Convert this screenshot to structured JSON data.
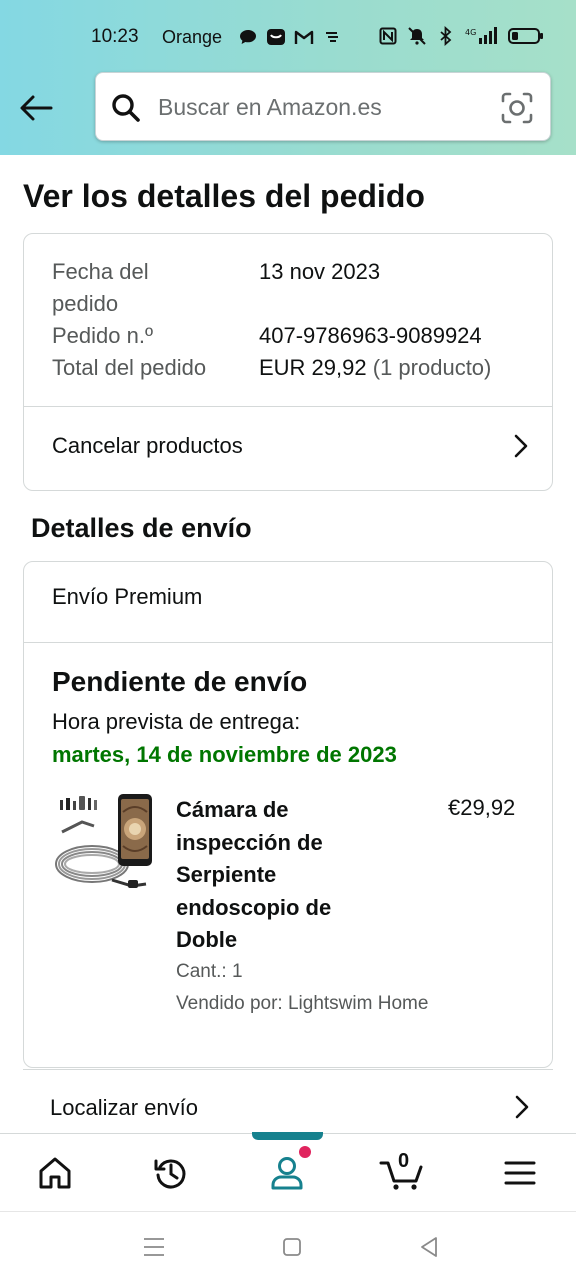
{
  "status_bar": {
    "time": "10:23",
    "carrier": "Orange",
    "icons_left": [
      "chat-bubble-icon",
      "mail-app-icon",
      "gmail-icon",
      "signal-alt-icon"
    ],
    "icons_right": [
      "nfc-icon",
      "mute-bell-icon",
      "bluetooth-icon",
      "4g-signal-icon",
      "battery-icon"
    ]
  },
  "header": {
    "back_icon": "arrow-left-icon",
    "search": {
      "placeholder": "Buscar en Amazon.es",
      "icon": "search-icon",
      "camera_icon": "camera-scan-icon"
    }
  },
  "page": {
    "title": "Ver los detalles del pedido"
  },
  "order": {
    "date_label_line1": "Fecha del",
    "date_label_line2": "pedido",
    "date_value": "13 nov 2023",
    "number_label": "Pedido n.º",
    "number_value": "407-9786963-9089924",
    "total_label": "Total del pedido",
    "total_value": "EUR 29,92",
    "total_suffix": "(1 producto)",
    "cancel_label": "Cancelar productos"
  },
  "shipping": {
    "section_title": "Detalles de envío",
    "type": "Envío Premium",
    "status": "Pendiente de envío",
    "eta_label": "Hora prevista de entrega:",
    "eta_date": "martes, 14 de noviembre de 2023",
    "product": {
      "name": "Cámara de inspección de Serpiente endoscopio de Doble",
      "price": "€29,92",
      "quantity": "Cant.: 1",
      "seller": "Vendido por: Lightswim Home"
    },
    "track_label": "Localizar envío"
  },
  "bottom_nav": {
    "items": [
      "home-icon",
      "history-icon",
      "account-icon",
      "cart-icon",
      "menu-icon"
    ],
    "active": "account-icon",
    "cart_count": "0",
    "colors": {
      "accent": "#16818e",
      "notification": "#e0245e",
      "eta_green": "#007600"
    }
  },
  "system_nav": [
    "recents-icon",
    "home-square-icon",
    "back-triangle-icon"
  ]
}
